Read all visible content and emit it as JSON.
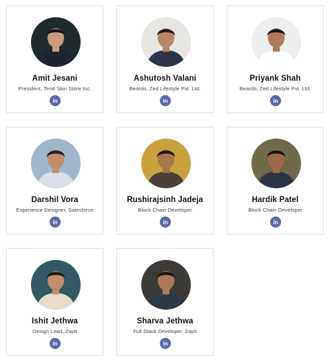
{
  "people": [
    {
      "name": "Amit Jesani",
      "title": "President, Tend Skin Store Inc.",
      "linkedin": "in",
      "bg": "#1f2a2d",
      "skin": "#c99a78",
      "shirt": "#1d2430",
      "hair": "#1a1512"
    },
    {
      "name": "Ashutosh Valani",
      "title": "Beardo, Zed Lifestyle Pvt. Ltd.",
      "linkedin": "in",
      "bg": "#e8e6e2",
      "skin": "#b98668",
      "shirt": "#2c3548",
      "hair": "#241c17"
    },
    {
      "name": "Priyank Shah",
      "title": "Beardo, Zed Lifestyle Pvt. Ltd.",
      "linkedin": "in",
      "bg": "#eeeeee",
      "skin": "#b07a58",
      "shirt": "#ffffff",
      "hair": "#1d1814"
    },
    {
      "name": "Darshil Vora",
      "title": "Experience Designer, Salesforce",
      "linkedin": "in",
      "bg": "#9fb6cc",
      "skin": "#c58e6c",
      "shirt": "#d8dde6",
      "hair": "#2a211b"
    },
    {
      "name": "Rushirajsinh Jadeja",
      "title": "Block Chain Developer",
      "linkedin": "in",
      "bg": "#c9a23d",
      "skin": "#a9764f",
      "shirt": "#4a4038",
      "hair": "#1b1510"
    },
    {
      "name": "Hardik Patel",
      "title": "Block Chain Developer",
      "linkedin": "in",
      "bg": "#6f6a4a",
      "skin": "#9c6a4a",
      "shirt": "#2e3542",
      "hair": "#16120f"
    },
    {
      "name": "Ishit Jethwa",
      "title": "Design Lead, Zapit",
      "linkedin": "in",
      "bg": "#2f5a66",
      "skin": "#c08d6a",
      "shirt": "#e7dcc9",
      "hair": "#221a15"
    },
    {
      "name": "Sharva Jethwa",
      "title": "Full Stack Developer, Zapit",
      "linkedin": "in",
      "bg": "#3d3b38",
      "skin": "#a97a5a",
      "shirt": "#2c3946",
      "hair": "#1a1511"
    }
  ]
}
